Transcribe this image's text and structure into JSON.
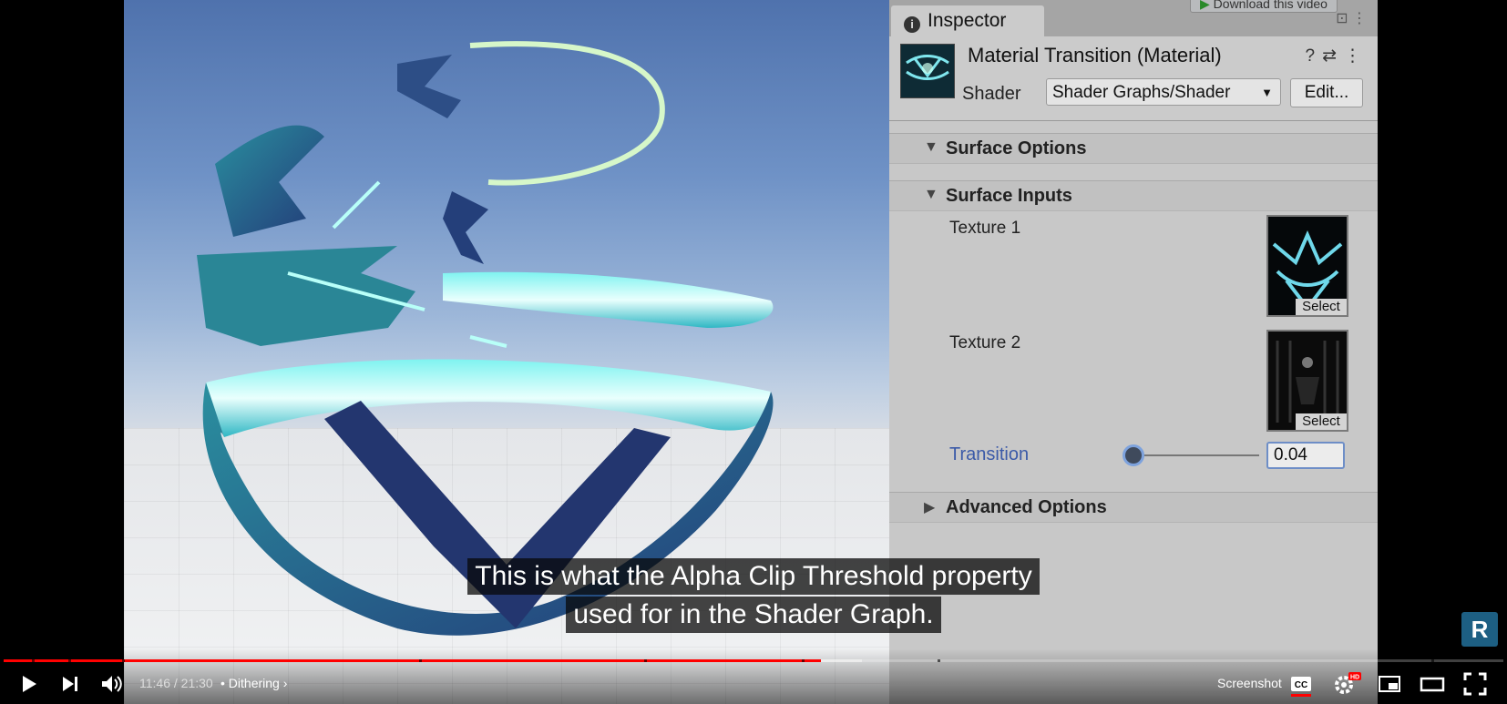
{
  "inspector": {
    "tab_label": "Inspector",
    "download_link": "Download this video",
    "material_title": "Material Transition (Material)",
    "shader_label": "Shader",
    "shader_value": "Shader Graphs/Shader",
    "edit_label": "Edit...",
    "sections": {
      "surface_options": "Surface Options",
      "surface_inputs": "Surface Inputs",
      "advanced_options": "Advanced Options"
    },
    "texture1_label": "Texture 1",
    "texture2_label": "Texture 2",
    "select_label": "Select",
    "transition_label": "Transition",
    "transition_value": "0.04",
    "transition_fraction": 0.04
  },
  "caption": {
    "line1": "This is what the Alpha Clip Threshold property",
    "line2": "used for in the Shader Graph."
  },
  "brand_badge": "R",
  "player": {
    "time": "11:46 / 21:30",
    "separator": "•",
    "chapter": "Dithering",
    "chapter_chevron": "›",
    "screenshot_label": "Screenshot",
    "cc_label": "CC",
    "hd_badge": "HD",
    "played_fraction": 0.545,
    "buffered_fraction": 0.572,
    "chapter_fractions": [
      0.019,
      0.043,
      0.079,
      0.277,
      0.427,
      0.532,
      0.623,
      0.952
    ],
    "colors": {
      "played": "#ff0000",
      "transition_label": "#3b5aa8"
    },
    "icons": [
      "play-icon",
      "next-icon",
      "volume-icon",
      "cc-icon",
      "settings-icon",
      "miniplayer-icon",
      "theater-icon",
      "fullscreen-icon"
    ]
  }
}
